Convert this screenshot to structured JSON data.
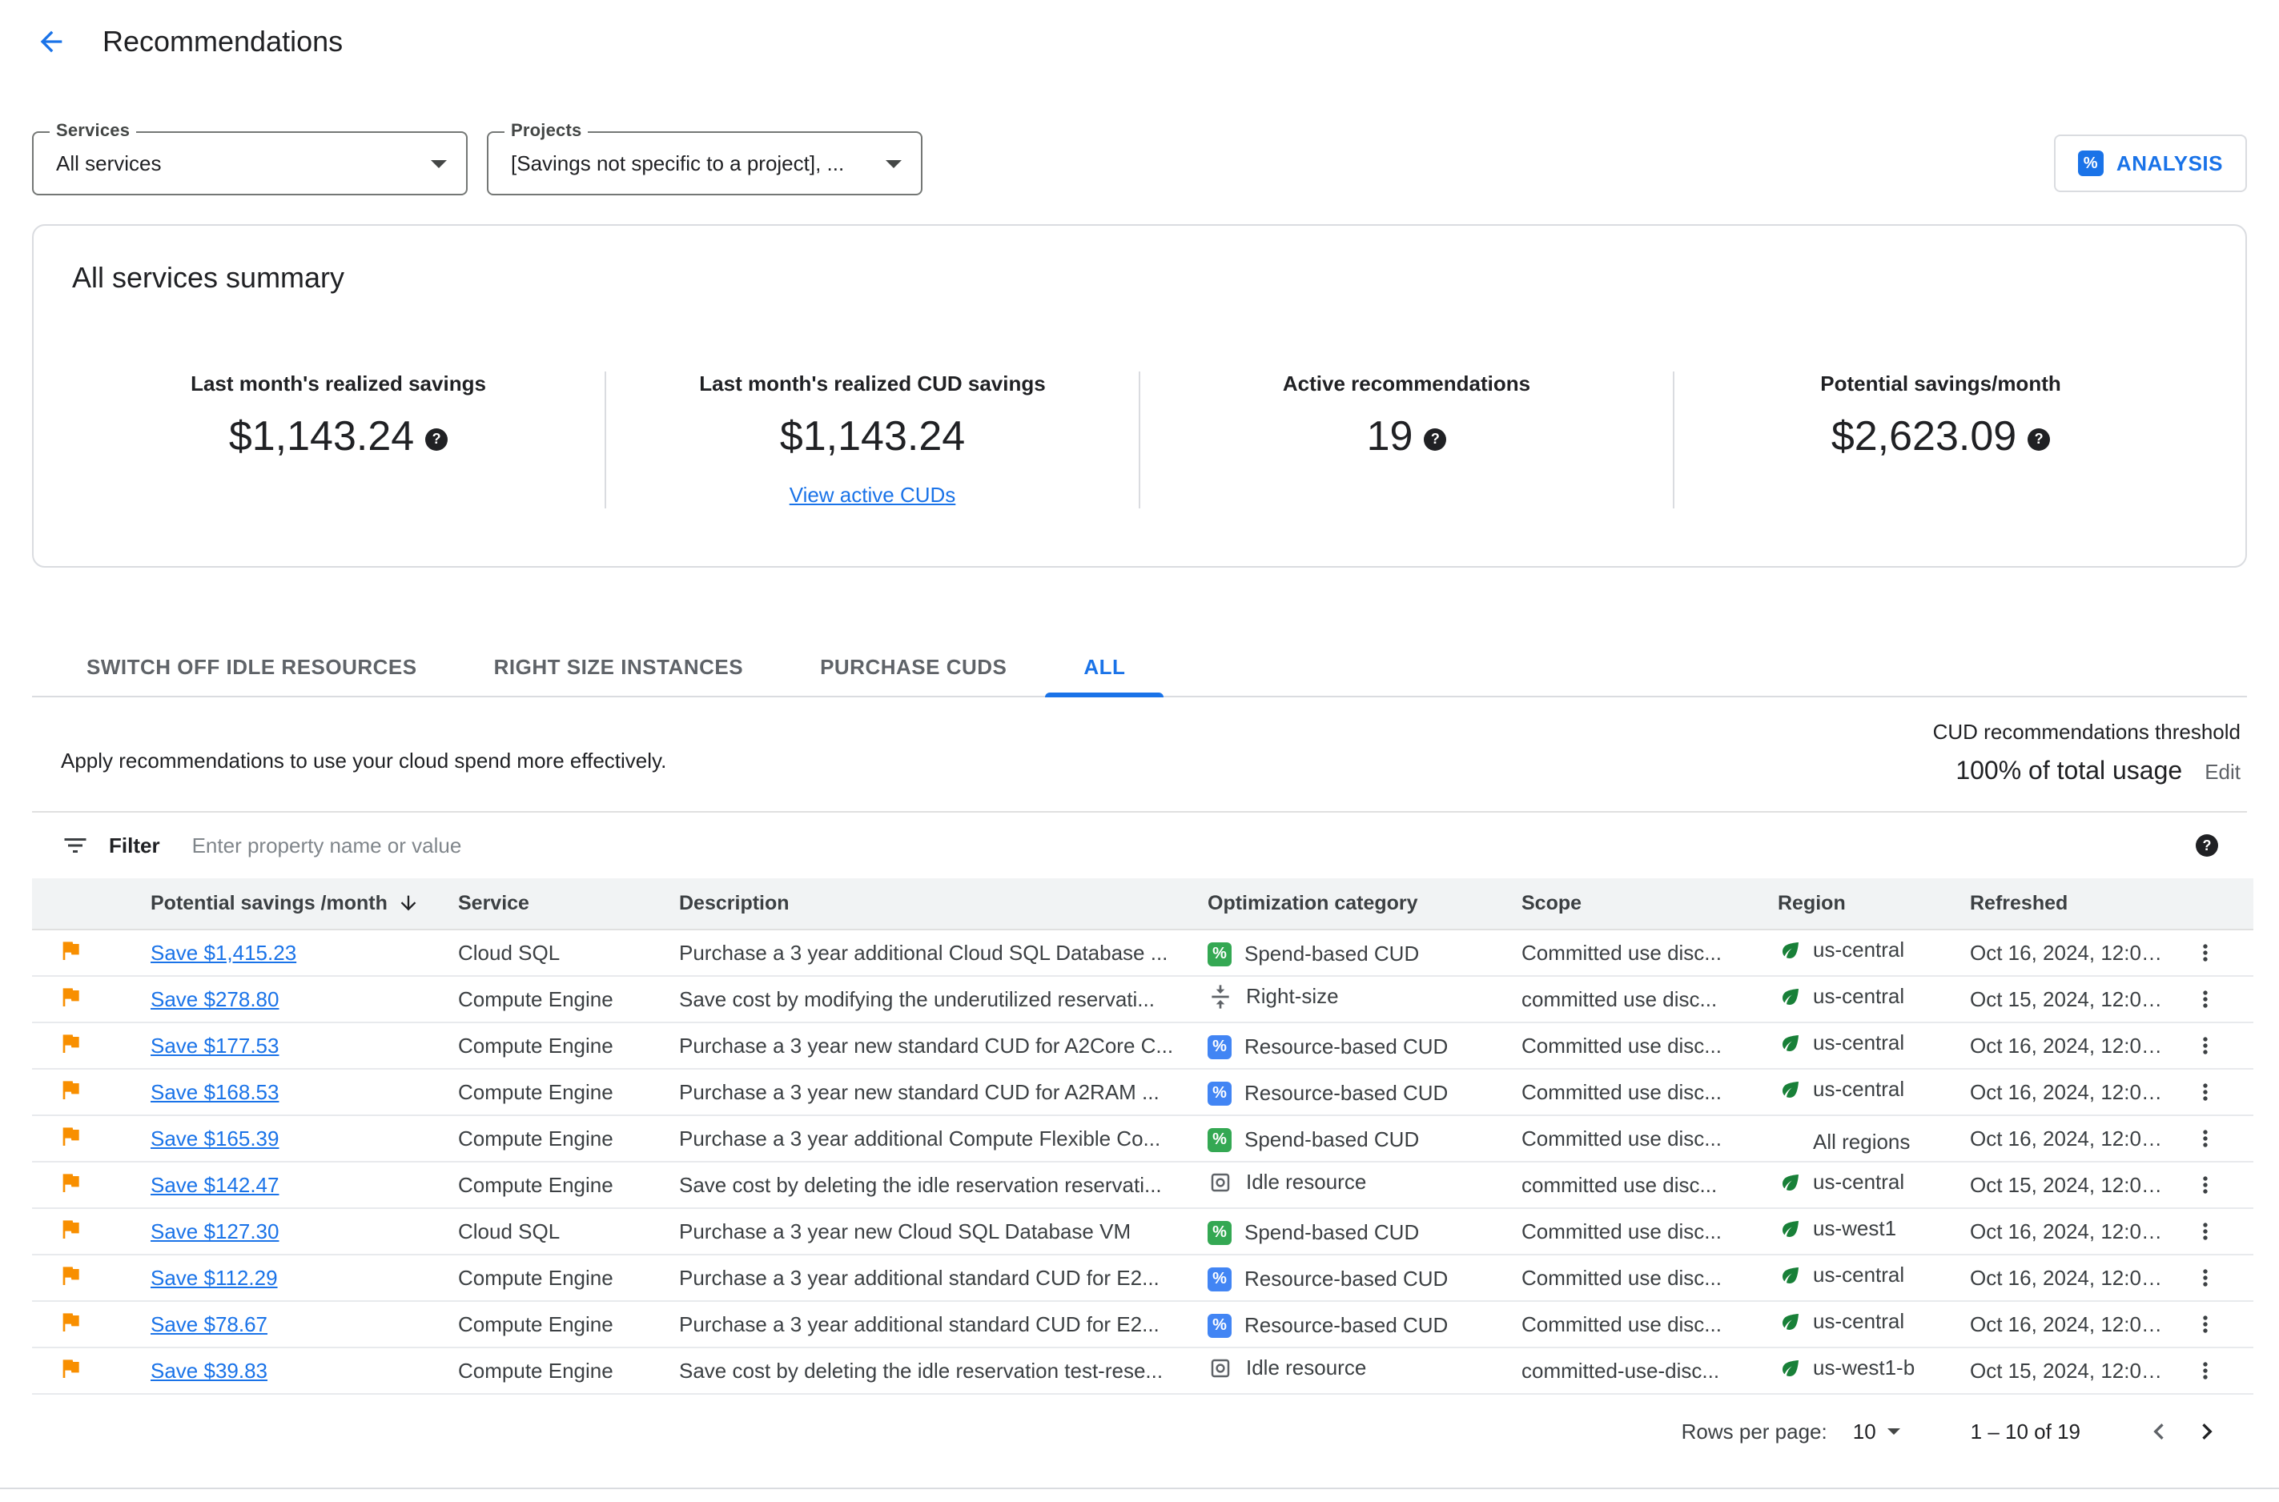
{
  "colors": {
    "accent_blue": "#1a73e8",
    "flag_orange": "#f88f00",
    "badge_green": "#34a853",
    "badge_blue": "#4285f4",
    "leaf_green": "#188038",
    "text_primary": "#202124",
    "text_secondary": "#5f6368",
    "border": "#dadce0",
    "table_header_bg": "#f1f3f4"
  },
  "glyphs": {
    "help": "?",
    "percent": "%"
  },
  "header": {
    "title": "Recommendations"
  },
  "filters": {
    "services": {
      "label": "Services",
      "value": "All services"
    },
    "projects": {
      "label": "Projects",
      "value": "[Savings not specific to a project], ..."
    },
    "analysis_button_label": "ANALYSIS"
  },
  "summary": {
    "title": "All services summary",
    "stats": [
      {
        "label": "Last month's realized savings",
        "value": "$1,143.24"
      },
      {
        "label": "Last month's realized CUD savings",
        "value": "$1,143.24",
        "link": "View active CUDs"
      },
      {
        "label": "Active recommendations",
        "value": "19"
      },
      {
        "label": "Potential savings/month",
        "value": "$2,623.09"
      }
    ]
  },
  "tabs": [
    {
      "label": "SWITCH OFF IDLE RESOURCES",
      "active": false
    },
    {
      "label": "RIGHT SIZE INSTANCES",
      "active": false
    },
    {
      "label": "PURCHASE CUDS",
      "active": false
    },
    {
      "label": "ALL",
      "active": true
    }
  ],
  "panel": {
    "description": "Apply recommendations to use your cloud spend more effectively.",
    "threshold": {
      "label": "CUD recommendations threshold",
      "value": "100% of total usage",
      "edit_label": "Edit"
    },
    "filter": {
      "label": "Filter",
      "placeholder": "Enter property name or value"
    }
  },
  "table": {
    "columns": {
      "savings": "Potential savings /month",
      "service": "Service",
      "description": "Description",
      "category": "Optimization category",
      "scope": "Scope",
      "region": "Region",
      "refreshed": "Refreshed"
    },
    "rows": [
      {
        "savings": "Save $1,415.23",
        "service": "Cloud SQL",
        "description": "Purchase a 3 year additional Cloud SQL Database ...",
        "category": "Spend-based CUD",
        "category_icon": "percent-green",
        "scope": "Committed use disc...",
        "region": "us-central",
        "region_icon": "leaf",
        "refreshed": "Oct 16, 2024, 12:00..."
      },
      {
        "savings": "Save $278.80",
        "service": "Compute Engine",
        "description": "Save cost by modifying the underutilized reservati...",
        "category": "Right-size",
        "category_icon": "right-size",
        "scope": "committed use disc...",
        "region": "us-central",
        "region_icon": "leaf",
        "refreshed": "Oct 15, 2024, 12:00..."
      },
      {
        "savings": "Save $177.53",
        "service": "Compute Engine",
        "description": "Purchase a 3 year new standard CUD for A2Core C...",
        "category": "Resource-based CUD",
        "category_icon": "percent-blue",
        "scope": "Committed use disc...",
        "region": "us-central",
        "region_icon": "leaf",
        "refreshed": "Oct 16, 2024, 12:00..."
      },
      {
        "savings": "Save $168.53",
        "service": "Compute Engine",
        "description": "Purchase a 3 year new standard CUD for A2RAM ...",
        "category": "Resource-based CUD",
        "category_icon": "percent-blue",
        "scope": "Committed use disc...",
        "region": "us-central",
        "region_icon": "leaf",
        "refreshed": "Oct 16, 2024, 12:00..."
      },
      {
        "savings": "Save $165.39",
        "service": "Compute Engine",
        "description": "Purchase a 3 year additional Compute Flexible Co...",
        "category": "Spend-based CUD",
        "category_icon": "percent-green",
        "scope": "Committed use disc...",
        "region": "All regions",
        "region_icon": "none",
        "refreshed": "Oct 16, 2024, 12:00..."
      },
      {
        "savings": "Save $142.47",
        "service": "Compute Engine",
        "description": "Save cost by deleting the idle reservation reservati...",
        "category": "Idle resource",
        "category_icon": "idle",
        "scope": "committed use disc...",
        "region": "us-central",
        "region_icon": "leaf",
        "refreshed": "Oct 15, 2024, 12:00..."
      },
      {
        "savings": "Save $127.30",
        "service": "Cloud SQL",
        "description": "Purchase a 3 year new Cloud SQL Database VM",
        "category": "Spend-based CUD",
        "category_icon": "percent-green",
        "scope": "Committed use disc...",
        "region": "us-west1",
        "region_icon": "leaf",
        "refreshed": "Oct 16, 2024, 12:00..."
      },
      {
        "savings": "Save $112.29",
        "service": "Compute Engine",
        "description": "Purchase a 3 year additional standard CUD for E2...",
        "category": "Resource-based CUD",
        "category_icon": "percent-blue",
        "scope": "Committed use disc...",
        "region": "us-central",
        "region_icon": "leaf",
        "refreshed": "Oct 16, 2024, 12:00..."
      },
      {
        "savings": "Save $78.67",
        "service": "Compute Engine",
        "description": "Purchase a 3 year additional standard CUD for E2...",
        "category": "Resource-based CUD",
        "category_icon": "percent-blue",
        "scope": "Committed use disc...",
        "region": "us-central",
        "region_icon": "leaf",
        "refreshed": "Oct 16, 2024, 12:00..."
      },
      {
        "savings": "Save $39.83",
        "service": "Compute Engine",
        "description": "Save cost by deleting the idle reservation test-rese...",
        "category": "Idle resource",
        "category_icon": "idle",
        "scope": "committed-use-disc...",
        "region": "us-west1-b",
        "region_icon": "leaf",
        "refreshed": "Oct 15, 2024, 12:00..."
      }
    ]
  },
  "pagination": {
    "rows_per_page_label": "Rows per page:",
    "rows_per_page_value": "10",
    "range_label": "1 – 10 of 19"
  }
}
